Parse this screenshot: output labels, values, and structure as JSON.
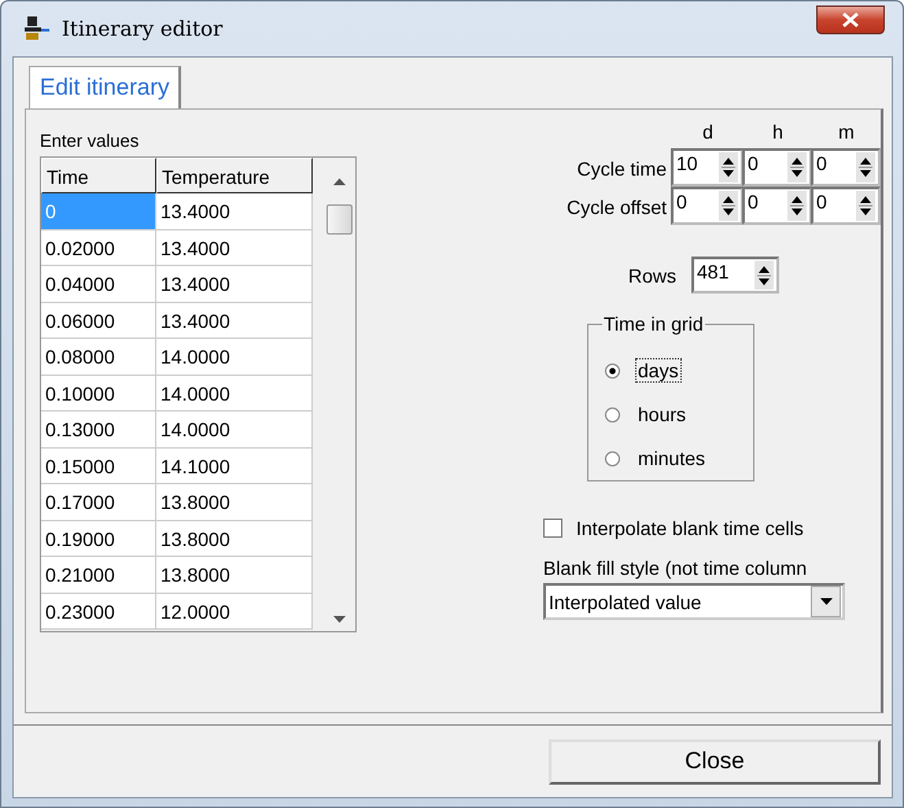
{
  "window": {
    "title": "Itinerary editor"
  },
  "tabs": [
    {
      "label": "Edit itinerary",
      "selected": true
    }
  ],
  "grid": {
    "label": "Enter values",
    "columns": [
      "Time",
      "Temperature"
    ],
    "rows": [
      {
        "cells": [
          "0",
          "13.4000"
        ],
        "selected": true
      },
      {
        "cells": [
          "0.02000",
          "13.4000"
        ],
        "selected": false
      },
      {
        "cells": [
          "0.04000",
          "13.4000"
        ],
        "selected": false
      },
      {
        "cells": [
          "0.06000",
          "13.4000"
        ],
        "selected": false
      },
      {
        "cells": [
          "0.08000",
          "14.0000"
        ],
        "selected": false
      },
      {
        "cells": [
          "0.10000",
          "14.0000"
        ],
        "selected": false
      },
      {
        "cells": [
          "0.13000",
          "14.0000"
        ],
        "selected": false
      },
      {
        "cells": [
          "0.15000",
          "14.1000"
        ],
        "selected": false
      },
      {
        "cells": [
          "0.17000",
          "13.8000"
        ],
        "selected": false
      },
      {
        "cells": [
          "0.19000",
          "13.8000"
        ],
        "selected": false
      },
      {
        "cells": [
          "0.21000",
          "13.8000"
        ],
        "selected": false
      },
      {
        "cells": [
          "0.23000",
          "12.0000"
        ],
        "selected": false
      }
    ]
  },
  "cycle": {
    "column_labels": [
      "d",
      "h",
      "m"
    ],
    "rows": [
      {
        "label": "Cycle time",
        "values": [
          "10",
          "0",
          "0"
        ]
      },
      {
        "label": "Cycle offset",
        "values": [
          "0",
          "0",
          "0"
        ]
      }
    ]
  },
  "rows_field": {
    "label": "Rows",
    "value": "481"
  },
  "time_in_grid": {
    "title": "Time in grid",
    "options": [
      {
        "label": "days",
        "selected": true
      },
      {
        "label": "hours",
        "selected": false
      },
      {
        "label": "minutes",
        "selected": false
      }
    ]
  },
  "interpolate": {
    "label": "Interpolate blank time cells",
    "checked": false
  },
  "blank_fill": {
    "label": "Blank fill style (not time column",
    "value": "Interpolated value"
  },
  "buttons": [
    {
      "label": "Close"
    }
  ]
}
